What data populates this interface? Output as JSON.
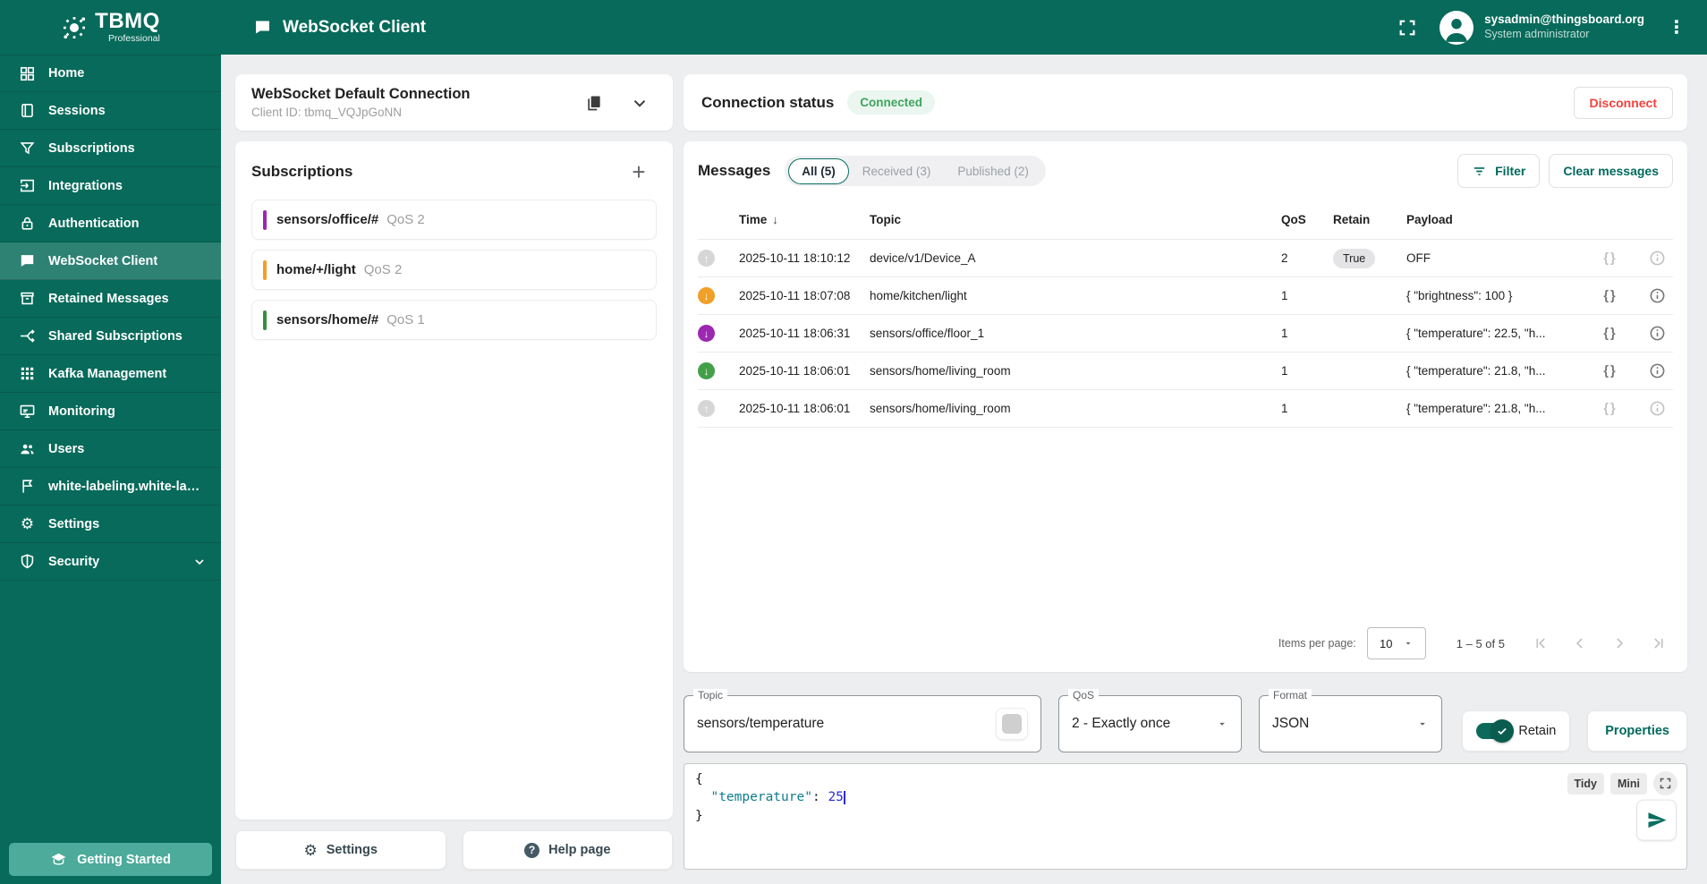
{
  "colors": {
    "sidebar_bg": "#076a5a",
    "sidebar_active_overlay": "rgba(255,255,255,0.16)",
    "getting_started_bg": "#4cab9b",
    "accent_teal": "#00695c",
    "connected_green": "#3fa45f",
    "connected_bg": "#eaf6ef",
    "disconnect_red": "#f5413d",
    "page_bg": "#eceef0",
    "editor_key": "#0d7d8c",
    "editor_number": "#2b2bd6"
  },
  "icons": {
    "gear": "⚙",
    "kebab": "⋮",
    "plus": "+",
    "braces": "{}",
    "arrow_up": "↑",
    "arrow_down": "↓",
    "sort_desc": "↓",
    "help": "?"
  },
  "brand": {
    "name": "TBMQ",
    "tagline": "Professional"
  },
  "header": {
    "title": "WebSocket Client",
    "user_email": "sysadmin@thingsboard.org",
    "user_role": "System administrator"
  },
  "sidebar": {
    "items": [
      {
        "label": "Home"
      },
      {
        "label": "Sessions"
      },
      {
        "label": "Subscriptions"
      },
      {
        "label": "Integrations"
      },
      {
        "label": "Authentication"
      },
      {
        "label": "WebSocket Client",
        "active": true
      },
      {
        "label": "Retained Messages"
      },
      {
        "label": "Shared Subscriptions"
      },
      {
        "label": "Kafka Management"
      },
      {
        "label": "Monitoring"
      },
      {
        "label": "Users"
      },
      {
        "label": "white-labeling.white-labeli..."
      },
      {
        "label": "Settings"
      },
      {
        "label": "Security"
      }
    ],
    "getting_started": "Getting Started"
  },
  "connection": {
    "name": "WebSocket Default Connection",
    "client_id": "Client ID: tbmq_VQJpGoNN"
  },
  "subscriptions": {
    "title": "Subscriptions",
    "items": [
      {
        "topic": "sensors/office/#",
        "qos": "QoS 2",
        "color": "#9c27b0"
      },
      {
        "topic": "home/+/light",
        "qos": "QoS 2",
        "color": "#f0a026"
      },
      {
        "topic": "sensors/home/#",
        "qos": "QoS 1",
        "color": "#388e3c"
      }
    ]
  },
  "left_footer": {
    "settings": "Settings",
    "help": "Help page"
  },
  "status": {
    "label": "Connection status",
    "value": "Connected",
    "disconnect": "Disconnect"
  },
  "messages": {
    "title": "Messages",
    "tabs": [
      {
        "label": "All (5)",
        "selected": true
      },
      {
        "label": "Received (3)"
      },
      {
        "label": "Published (2)"
      }
    ],
    "filter": "Filter",
    "clear": "Clear messages",
    "columns": {
      "time": "Time",
      "topic": "Topic",
      "qos": "QoS",
      "retain": "Retain",
      "payload": "Payload"
    },
    "rows": [
      {
        "direction": "published",
        "icon_color": "#d6d6d6",
        "time": "2025-10-11 18:10:12",
        "topic": "device/v1/Device_A",
        "qos": "2",
        "retain": "True",
        "payload": "OFF"
      },
      {
        "direction": "received",
        "icon_color": "#f0a026",
        "time": "2025-10-11 18:07:08",
        "topic": "home/kitchen/light",
        "qos": "1",
        "retain": "",
        "payload": "{ \"brightness\": 100 }"
      },
      {
        "direction": "received",
        "icon_color": "#9c27b0",
        "time": "2025-10-11 18:06:31",
        "topic": "sensors/office/floor_1",
        "qos": "1",
        "retain": "",
        "payload": "{ \"temperature\": 22.5, \"h..."
      },
      {
        "direction": "received",
        "icon_color": "#43a047",
        "time": "2025-10-11 18:06:01",
        "topic": "sensors/home/living_room",
        "qos": "1",
        "retain": "",
        "payload": "{ \"temperature\": 21.8, \"h..."
      },
      {
        "direction": "published",
        "icon_color": "#d6d6d6",
        "time": "2025-10-11 18:06:01",
        "topic": "sensors/home/living_room",
        "qos": "1",
        "retain": "",
        "payload": "{ \"temperature\": 21.8, \"h..."
      }
    ],
    "pagination": {
      "items_per_page_label": "Items per page:",
      "items_per_page": "10",
      "range": "1 – 5 of 5"
    }
  },
  "publish": {
    "topic_label": "Topic",
    "topic_value": "sensors/temperature",
    "qos_label": "QoS",
    "qos_value": "2 - Exactly once",
    "format_label": "Format",
    "format_value": "JSON",
    "retain_label": "Retain",
    "properties_label": "Properties",
    "editor": {
      "open_brace": "{",
      "indent": "  ",
      "key": "\"temperature\"",
      "colon": ": ",
      "value": "25",
      "close_brace": "}",
      "tidy": "Tidy",
      "mini": "Mini"
    }
  }
}
